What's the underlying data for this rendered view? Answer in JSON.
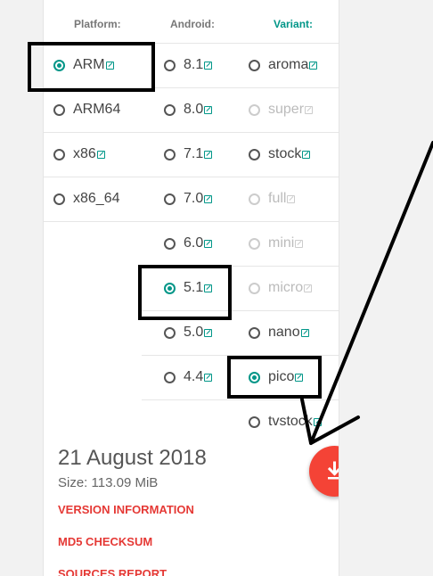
{
  "headers": {
    "platform": "Platform:",
    "android": "Android:",
    "variant": "Variant:"
  },
  "platforms": [
    {
      "label": "ARM",
      "checked": true,
      "link": true
    },
    {
      "label": "ARM64",
      "checked": false,
      "link": false
    },
    {
      "label": "x86",
      "checked": false,
      "link": true
    },
    {
      "label": "x86_64",
      "checked": false,
      "link": false
    }
  ],
  "android": [
    {
      "label": "8.1",
      "checked": false
    },
    {
      "label": "8.0",
      "checked": false
    },
    {
      "label": "7.1",
      "checked": false
    },
    {
      "label": "7.0",
      "checked": false
    },
    {
      "label": "6.0",
      "checked": false
    },
    {
      "label": "5.1",
      "checked": true
    },
    {
      "label": "5.0",
      "checked": false
    },
    {
      "label": "4.4",
      "checked": false
    }
  ],
  "variants": [
    {
      "label": "aroma",
      "enabled": true,
      "checked": false
    },
    {
      "label": "super",
      "enabled": false,
      "checked": false
    },
    {
      "label": "stock",
      "enabled": true,
      "checked": false
    },
    {
      "label": "full",
      "enabled": false,
      "checked": false
    },
    {
      "label": "mini",
      "enabled": false,
      "checked": false
    },
    {
      "label": "micro",
      "enabled": false,
      "checked": false
    },
    {
      "label": "nano",
      "enabled": true,
      "checked": false
    },
    {
      "label": "pico",
      "enabled": true,
      "checked": true
    },
    {
      "label": "tvstock",
      "enabled": true,
      "checked": false
    }
  ],
  "release": {
    "date": "21 August 2018",
    "size": "Size: 113.09 MiB",
    "links": [
      "VERSION INFORMATION",
      "MD5 CHECKSUM",
      "SOURCES REPORT"
    ]
  },
  "colors": {
    "accent": "#009688",
    "fab": "#f44336",
    "link": "#e53935"
  },
  "icons": {
    "download": "download-icon",
    "external": "external-link-icon"
  }
}
